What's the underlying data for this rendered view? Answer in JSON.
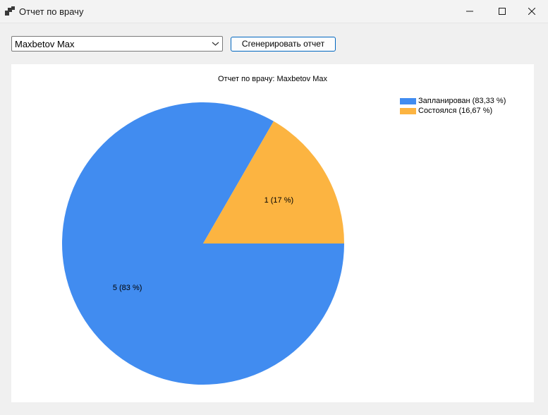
{
  "window": {
    "title": "Отчет по врачу",
    "controls": {
      "minimize_icon": "minimize-icon",
      "maximize_icon": "maximize-icon",
      "close_icon": "close-icon"
    }
  },
  "toolbar": {
    "doctor_select_value": "Maxbetov Max",
    "generate_button_label": "Сгенерировать отчет"
  },
  "chart_data": {
    "type": "pie",
    "title": "Отчет по врачу: Maxbetov Max",
    "categories": [
      "Запланирован",
      "Состоялся"
    ],
    "values": [
      5,
      1
    ],
    "colors": [
      "#418cf0",
      "#fcb441"
    ],
    "data_labels": [
      "5 (83 %)",
      "1 (17 %)"
    ],
    "legend": [
      {
        "label": "Запланирован (83,33 %)",
        "color": "#418cf0"
      },
      {
        "label": "Состоялся (16,67 %)",
        "color": "#fcb441"
      }
    ],
    "legend_position": "top-right"
  }
}
